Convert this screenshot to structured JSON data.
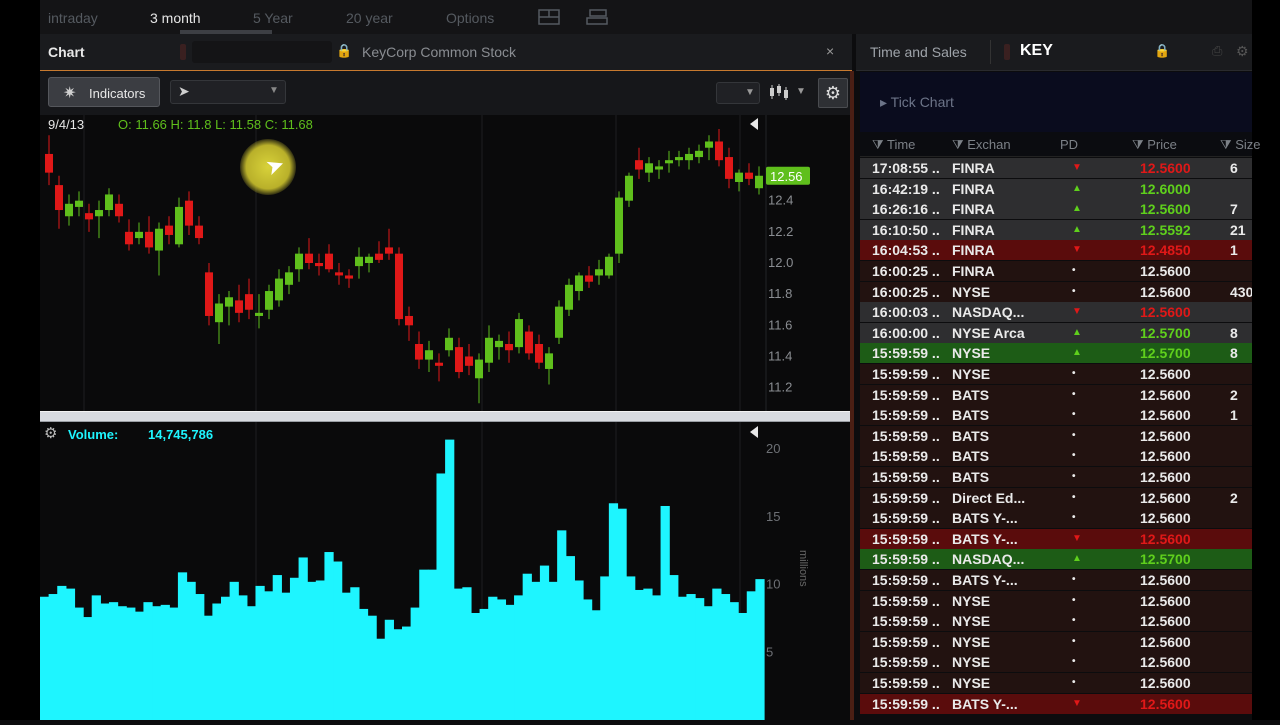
{
  "top_tabs": [
    "intraday",
    "3 month",
    "5 Year",
    "20 year",
    "Options"
  ],
  "active_tab_index": 1,
  "chart_panel": {
    "title": "Chart",
    "company": "KeyCorp Common Stock",
    "close_glyph": "×",
    "indicators_label": "Indicators",
    "cursor_mode_value": "",
    "gear_glyph": "⚙"
  },
  "ts_panel": {
    "title": "Time and Sales",
    "symbol": "KEY",
    "tick_chart": "▸ Tick Chart",
    "columns": [
      "Time",
      "Exchan",
      "PD",
      "Price",
      "Size"
    ]
  },
  "ohlc_readout": {
    "date": "9/4/13",
    "text": "O: 11.66  H: 11.8  L: 11.58  C: 11.68"
  },
  "volume_readout": {
    "label": "Volume:",
    "value": "14,745,786"
  },
  "colors": {
    "up": "#5fbf1c",
    "down": "#e01818",
    "volume": "#1ef5ff",
    "price_badge": "#5fbf1c",
    "red_row": "#5a0c0c",
    "green_row": "#1d5c16",
    "gray_row": "#2e2e30",
    "dark_red_row": "#221210"
  },
  "chart_data": [
    {
      "type": "candlestick",
      "y_axis_ticks": [
        "12.4",
        "12.2",
        "12.0",
        "11.8",
        "11.6",
        "11.4",
        "11.2"
      ],
      "ylim": [
        11.05,
        12.95
      ],
      "last_price_label": "12.56",
      "candles": [
        {
          "o": 12.7,
          "h": 12.82,
          "l": 12.5,
          "c": 12.58
        },
        {
          "o": 12.5,
          "h": 12.56,
          "l": 12.22,
          "c": 12.34
        },
        {
          "o": 12.3,
          "h": 12.44,
          "l": 12.24,
          "c": 12.38
        },
        {
          "o": 12.36,
          "h": 12.46,
          "l": 12.3,
          "c": 12.4
        },
        {
          "o": 12.32,
          "h": 12.38,
          "l": 12.2,
          "c": 12.28
        },
        {
          "o": 12.3,
          "h": 12.4,
          "l": 12.16,
          "c": 12.34
        },
        {
          "o": 12.34,
          "h": 12.48,
          "l": 12.3,
          "c": 12.44
        },
        {
          "o": 12.38,
          "h": 12.44,
          "l": 12.26,
          "c": 12.3
        },
        {
          "o": 12.2,
          "h": 12.28,
          "l": 12.08,
          "c": 12.12
        },
        {
          "o": 12.16,
          "h": 12.26,
          "l": 12.12,
          "c": 12.2
        },
        {
          "o": 12.2,
          "h": 12.3,
          "l": 12.06,
          "c": 12.1
        },
        {
          "o": 12.08,
          "h": 12.26,
          "l": 11.92,
          "c": 12.22
        },
        {
          "o": 12.24,
          "h": 12.3,
          "l": 12.12,
          "c": 12.18
        },
        {
          "o": 12.12,
          "h": 12.42,
          "l": 12.1,
          "c": 12.36
        },
        {
          "o": 12.4,
          "h": 12.46,
          "l": 12.18,
          "c": 12.24
        },
        {
          "o": 12.24,
          "h": 12.3,
          "l": 12.12,
          "c": 12.16
        },
        {
          "o": 11.94,
          "h": 12.0,
          "l": 11.6,
          "c": 11.66
        },
        {
          "o": 11.62,
          "h": 11.8,
          "l": 11.48,
          "c": 11.74
        },
        {
          "o": 11.72,
          "h": 11.82,
          "l": 11.6,
          "c": 11.78
        },
        {
          "o": 11.76,
          "h": 11.86,
          "l": 11.62,
          "c": 11.68
        },
        {
          "o": 11.8,
          "h": 11.9,
          "l": 11.64,
          "c": 11.7
        },
        {
          "o": 11.66,
          "h": 11.8,
          "l": 11.58,
          "c": 11.68
        },
        {
          "o": 11.7,
          "h": 11.86,
          "l": 11.64,
          "c": 11.82
        },
        {
          "o": 11.76,
          "h": 11.96,
          "l": 11.72,
          "c": 11.9
        },
        {
          "o": 11.86,
          "h": 11.98,
          "l": 11.8,
          "c": 11.94
        },
        {
          "o": 11.96,
          "h": 12.1,
          "l": 11.88,
          "c": 12.06
        },
        {
          "o": 12.06,
          "h": 12.16,
          "l": 11.96,
          "c": 12.0
        },
        {
          "o": 12.0,
          "h": 12.06,
          "l": 11.92,
          "c": 11.98
        },
        {
          "o": 12.06,
          "h": 12.12,
          "l": 11.94,
          "c": 11.96
        },
        {
          "o": 11.94,
          "h": 12.0,
          "l": 11.86,
          "c": 11.92
        },
        {
          "o": 11.92,
          "h": 11.96,
          "l": 11.84,
          "c": 11.9
        },
        {
          "o": 11.98,
          "h": 12.1,
          "l": 11.9,
          "c": 12.04
        },
        {
          "o": 12.0,
          "h": 12.06,
          "l": 11.94,
          "c": 12.04
        },
        {
          "o": 12.06,
          "h": 12.14,
          "l": 12.0,
          "c": 12.02
        },
        {
          "o": 12.1,
          "h": 12.22,
          "l": 12.02,
          "c": 12.06
        },
        {
          "o": 12.06,
          "h": 12.1,
          "l": 11.6,
          "c": 11.64
        },
        {
          "o": 11.66,
          "h": 11.72,
          "l": 11.5,
          "c": 11.6
        },
        {
          "o": 11.48,
          "h": 11.56,
          "l": 11.32,
          "c": 11.38
        },
        {
          "o": 11.38,
          "h": 11.5,
          "l": 11.3,
          "c": 11.44
        },
        {
          "o": 11.36,
          "h": 11.42,
          "l": 11.24,
          "c": 11.34
        },
        {
          "o": 11.44,
          "h": 11.58,
          "l": 11.4,
          "c": 11.52
        },
        {
          "o": 11.46,
          "h": 11.52,
          "l": 11.26,
          "c": 11.3
        },
        {
          "o": 11.4,
          "h": 11.48,
          "l": 11.28,
          "c": 11.34
        },
        {
          "o": 11.26,
          "h": 11.42,
          "l": 11.1,
          "c": 11.38
        },
        {
          "o": 11.36,
          "h": 11.6,
          "l": 11.3,
          "c": 11.52
        },
        {
          "o": 11.46,
          "h": 11.54,
          "l": 11.38,
          "c": 11.5
        },
        {
          "o": 11.48,
          "h": 11.56,
          "l": 11.36,
          "c": 11.44
        },
        {
          "o": 11.46,
          "h": 11.68,
          "l": 11.42,
          "c": 11.64
        },
        {
          "o": 11.56,
          "h": 11.6,
          "l": 11.38,
          "c": 11.42
        },
        {
          "o": 11.48,
          "h": 11.54,
          "l": 11.32,
          "c": 11.36
        },
        {
          "o": 11.32,
          "h": 11.46,
          "l": 11.22,
          "c": 11.42
        },
        {
          "o": 11.52,
          "h": 11.76,
          "l": 11.48,
          "c": 11.72
        },
        {
          "o": 11.7,
          "h": 11.9,
          "l": 11.66,
          "c": 11.86
        },
        {
          "o": 11.82,
          "h": 11.94,
          "l": 11.76,
          "c": 11.92
        },
        {
          "o": 11.92,
          "h": 11.98,
          "l": 11.84,
          "c": 11.88
        },
        {
          "o": 11.92,
          "h": 12.02,
          "l": 11.86,
          "c": 11.96
        },
        {
          "o": 11.92,
          "h": 12.06,
          "l": 11.9,
          "c": 12.04
        },
        {
          "o": 12.06,
          "h": 12.46,
          "l": 12.0,
          "c": 12.42
        },
        {
          "o": 12.4,
          "h": 12.58,
          "l": 12.36,
          "c": 12.56
        },
        {
          "o": 12.66,
          "h": 12.74,
          "l": 12.54,
          "c": 12.6
        },
        {
          "o": 12.58,
          "h": 12.68,
          "l": 12.52,
          "c": 12.64
        },
        {
          "o": 12.6,
          "h": 12.66,
          "l": 12.54,
          "c": 12.62
        },
        {
          "o": 12.64,
          "h": 12.72,
          "l": 12.58,
          "c": 12.66
        },
        {
          "o": 12.66,
          "h": 12.72,
          "l": 12.62,
          "c": 12.68
        },
        {
          "o": 12.66,
          "h": 12.74,
          "l": 12.6,
          "c": 12.7
        },
        {
          "o": 12.68,
          "h": 12.76,
          "l": 12.64,
          "c": 12.72
        },
        {
          "o": 12.74,
          "h": 12.82,
          "l": 12.66,
          "c": 12.78
        },
        {
          "o": 12.78,
          "h": 12.86,
          "l": 12.62,
          "c": 12.66
        },
        {
          "o": 12.68,
          "h": 12.74,
          "l": 12.48,
          "c": 12.54
        },
        {
          "o": 12.52,
          "h": 12.6,
          "l": 12.46,
          "c": 12.58
        },
        {
          "o": 12.58,
          "h": 12.64,
          "l": 12.5,
          "c": 12.54
        },
        {
          "o": 12.48,
          "h": 12.62,
          "l": 12.44,
          "c": 12.56
        }
      ]
    },
    {
      "type": "bar",
      "title": "Volume",
      "y_axis_ticks": [
        "20",
        "15",
        "10",
        "5"
      ],
      "ylabel": "millions",
      "ylim": [
        0,
        22
      ],
      "values": [
        9.1,
        9.3,
        9.9,
        9.7,
        8.3,
        7.6,
        9.2,
        8.6,
        8.7,
        8.4,
        8.3,
        8.0,
        8.7,
        8.4,
        8.5,
        8.3,
        10.9,
        10.2,
        9.3,
        7.7,
        8.6,
        9.1,
        10.2,
        9.2,
        8.4,
        9.9,
        9.5,
        10.7,
        9.4,
        10.5,
        12.0,
        10.2,
        10.3,
        12.4,
        11.7,
        9.4,
        9.8,
        8.2,
        7.7,
        6.0,
        7.4,
        6.7,
        6.9,
        8.3,
        11.1,
        11.1,
        18.2,
        20.7,
        9.7,
        9.8,
        7.9,
        8.2,
        9.1,
        8.9,
        8.5,
        9.2,
        10.8,
        10.2,
        11.4,
        10.2,
        14.0,
        12.1,
        10.3,
        8.9,
        8.1,
        10.6,
        16.0,
        15.6,
        10.6,
        9.6,
        9.7,
        9.2,
        15.8,
        10.7,
        9.1,
        9.3,
        9.0,
        8.4,
        9.7,
        9.3,
        8.7,
        7.9,
        9.5,
        10.4
      ]
    }
  ],
  "trades": [
    {
      "time": "17:08:55",
      "exch": "FINRA",
      "pd": "▼",
      "price": "12.5600",
      "size": "6",
      "row": "gray",
      "pc": "red"
    },
    {
      "time": "16:42:19",
      "exch": "FINRA",
      "pd": "▲",
      "price": "12.6000",
      "size": "",
      "row": "gray",
      "pc": "green"
    },
    {
      "time": "16:26:16",
      "exch": "FINRA",
      "pd": "▲",
      "price": "12.5600",
      "size": "7",
      "row": "gray",
      "pc": "green"
    },
    {
      "time": "16:10:50",
      "exch": "FINRA",
      "pd": "▲",
      "price": "12.5592",
      "size": "21",
      "row": "gray",
      "pc": "green"
    },
    {
      "time": "16:04:53",
      "exch": "FINRA",
      "pd": "▼",
      "price": "12.4850",
      "size": "1",
      "row": "red",
      "pc": "red"
    },
    {
      "time": "16:00:25",
      "exch": "FINRA",
      "pd": "•",
      "price": "12.5600",
      "size": "",
      "row": "dark",
      "pc": "white"
    },
    {
      "time": "16:00:25",
      "exch": "NYSE",
      "pd": "•",
      "price": "12.5600",
      "size": "430",
      "row": "dark",
      "pc": "white"
    },
    {
      "time": "16:00:03",
      "exch": "NASDAQ...",
      "pd": "▼",
      "price": "12.5600",
      "size": "",
      "row": "gray",
      "pc": "red"
    },
    {
      "time": "16:00:00",
      "exch": "NYSE Arca",
      "pd": "▲",
      "price": "12.5700",
      "size": "8",
      "row": "gray",
      "pc": "green"
    },
    {
      "time": "15:59:59",
      "exch": "NYSE",
      "pd": "▲",
      "price": "12.5700",
      "size": "8",
      "row": "green",
      "pc": "green"
    },
    {
      "time": "15:59:59",
      "exch": "NYSE",
      "pd": "•",
      "price": "12.5600",
      "size": "",
      "row": "dark",
      "pc": "white"
    },
    {
      "time": "15:59:59",
      "exch": "BATS",
      "pd": "•",
      "price": "12.5600",
      "size": "2",
      "row": "dark",
      "pc": "white"
    },
    {
      "time": "15:59:59",
      "exch": "BATS",
      "pd": "•",
      "price": "12.5600",
      "size": "1",
      "row": "dark",
      "pc": "white"
    },
    {
      "time": "15:59:59",
      "exch": "BATS",
      "pd": "•",
      "price": "12.5600",
      "size": "",
      "row": "dark",
      "pc": "white"
    },
    {
      "time": "15:59:59",
      "exch": "BATS",
      "pd": "•",
      "price": "12.5600",
      "size": "",
      "row": "dark",
      "pc": "white"
    },
    {
      "time": "15:59:59",
      "exch": "BATS",
      "pd": "•",
      "price": "12.5600",
      "size": "",
      "row": "dark",
      "pc": "white"
    },
    {
      "time": "15:59:59",
      "exch": "Direct Ed...",
      "pd": "•",
      "price": "12.5600",
      "size": "2",
      "row": "dark",
      "pc": "white"
    },
    {
      "time": "15:59:59",
      "exch": "BATS Y-...",
      "pd": "•",
      "price": "12.5600",
      "size": "",
      "row": "dark",
      "pc": "white"
    },
    {
      "time": "15:59:59",
      "exch": "BATS Y-...",
      "pd": "▼",
      "price": "12.5600",
      "size": "",
      "row": "red",
      "pc": "red"
    },
    {
      "time": "15:59:59",
      "exch": "NASDAQ...",
      "pd": "▲",
      "price": "12.5700",
      "size": "",
      "row": "green",
      "pc": "green"
    },
    {
      "time": "15:59:59",
      "exch": "BATS Y-...",
      "pd": "•",
      "price": "12.5600",
      "size": "",
      "row": "dark",
      "pc": "white"
    },
    {
      "time": "15:59:59",
      "exch": "NYSE",
      "pd": "•",
      "price": "12.5600",
      "size": "",
      "row": "dark",
      "pc": "white"
    },
    {
      "time": "15:59:59",
      "exch": "NYSE",
      "pd": "•",
      "price": "12.5600",
      "size": "",
      "row": "dark",
      "pc": "white"
    },
    {
      "time": "15:59:59",
      "exch": "NYSE",
      "pd": "•",
      "price": "12.5600",
      "size": "",
      "row": "dark",
      "pc": "white"
    },
    {
      "time": "15:59:59",
      "exch": "NYSE",
      "pd": "•",
      "price": "12.5600",
      "size": "",
      "row": "dark",
      "pc": "white"
    },
    {
      "time": "15:59:59",
      "exch": "NYSE",
      "pd": "•",
      "price": "12.5600",
      "size": "",
      "row": "dark",
      "pc": "white"
    },
    {
      "time": "15:59:59",
      "exch": "BATS Y-...",
      "pd": "▼",
      "price": "12.5600",
      "size": "",
      "row": "red",
      "pc": "red"
    }
  ]
}
